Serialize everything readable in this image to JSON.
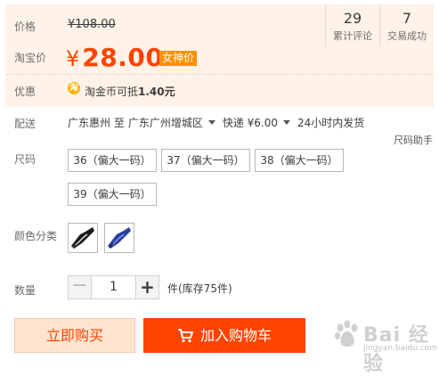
{
  "price": {
    "label": "价格",
    "original": "¥108.00",
    "promo_label": "淘宝价",
    "currency": "¥",
    "current": "28.00",
    "badge": "女神价",
    "discount_label": "优惠",
    "coin_icon": "淘",
    "coin_text": "淘金币可抵",
    "coin_amount": "1.40元"
  },
  "stats": [
    {
      "value": "29",
      "label": "累计评论"
    },
    {
      "value": "7",
      "label": "交易成功"
    }
  ],
  "shipping": {
    "label": "配送",
    "from": "广东惠州 至",
    "to": "广东广州增城区",
    "method": "快递 ¥6.00",
    "time": "24小时内发货",
    "size_helper": "尺码助手"
  },
  "size": {
    "label": "尺码",
    "options": [
      "36（偏大一码）",
      "37（偏大一码）",
      "38（偏大一码）",
      "39（偏大一码）"
    ]
  },
  "color": {
    "label": "颜色分类",
    "options": [
      {
        "name": "black-shoe",
        "color": "#1a1a1a"
      },
      {
        "name": "blue-shoe",
        "color": "#2c3fa0"
      }
    ]
  },
  "quantity": {
    "label": "数量",
    "value": "1",
    "minus": "−",
    "plus": "+",
    "stock": "件(库存75件)"
  },
  "actions": {
    "buy_now": "立即购买",
    "add_cart": "加入购物车"
  },
  "watermark": {
    "text": "Bai 经验",
    "url": "jingyan.baidu.com"
  },
  "colors": {
    "accent": "#ff4400",
    "panel_bg": "#fff2e8",
    "badge_bg": "#ff9000"
  }
}
